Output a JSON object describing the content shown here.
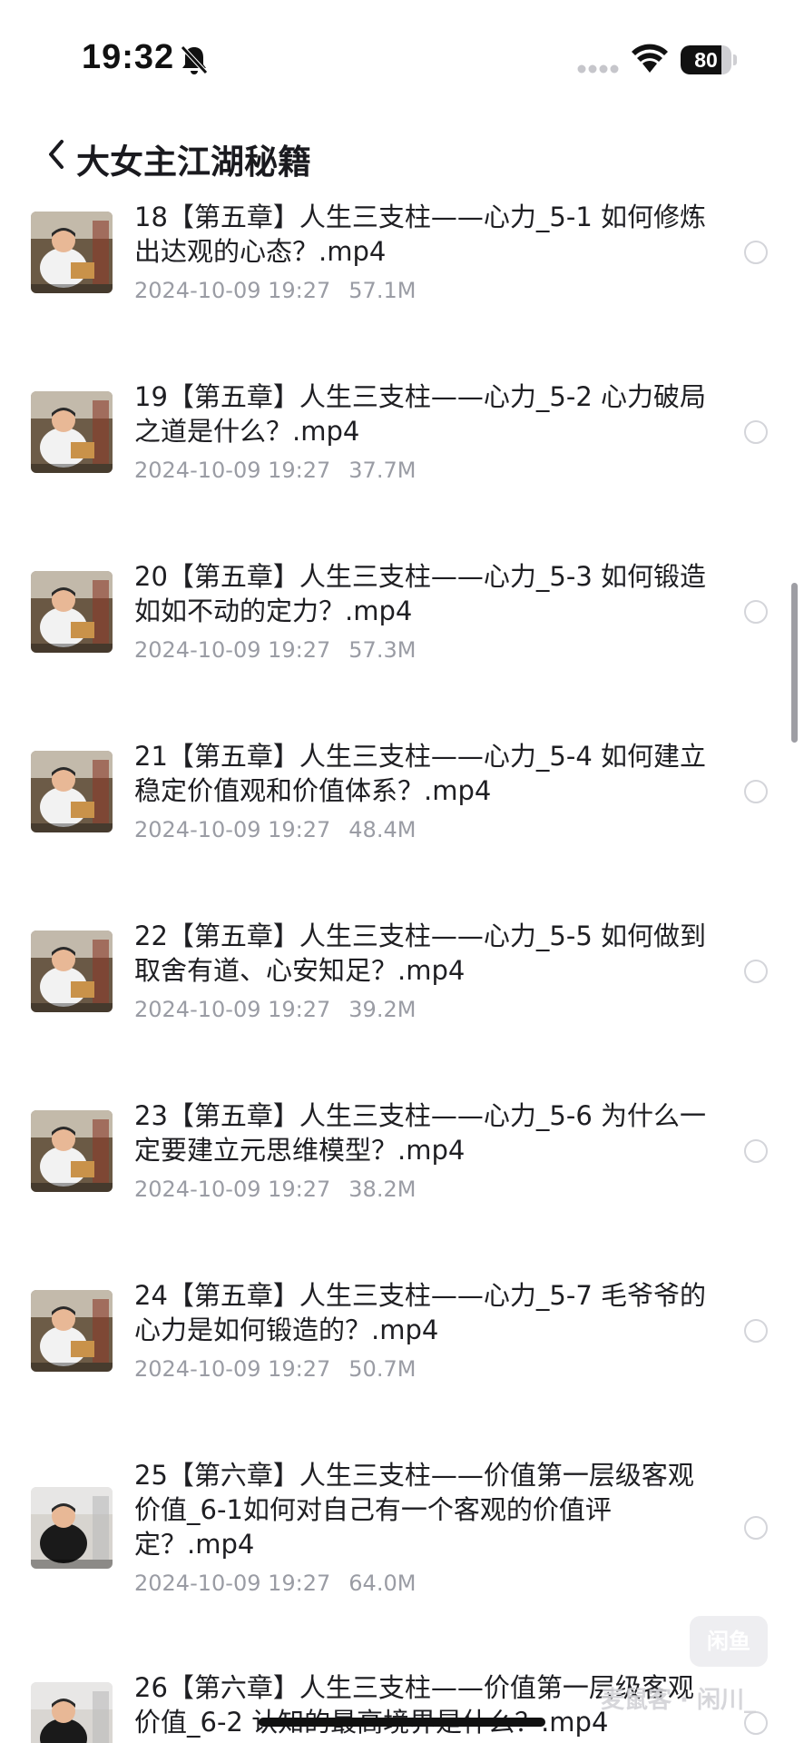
{
  "status_bar": {
    "time": "19:32",
    "battery_level": "80",
    "battery_fraction": 0.8,
    "icons": [
      "bell-slash-icon",
      "signal-dots-icon",
      "wifi-icon",
      "battery-icon"
    ]
  },
  "nav": {
    "back_icon": "chevron-left-icon",
    "title": "大女主江湖秘籍"
  },
  "files": [
    {
      "name": "18【第五章】人生三支柱——心力_5-1 如何修炼出达观的心态？.mp4",
      "date": "2024-10-09 19:27",
      "size": "57.1M"
    },
    {
      "name": "19【第五章】人生三支柱——心力_5-2 心力破局之道是什么？.mp4",
      "date": "2024-10-09 19:27",
      "size": "37.7M"
    },
    {
      "name": "20【第五章】人生三支柱——心力_5-3 如何锻造如如不动的定力？.mp4",
      "date": "2024-10-09 19:27",
      "size": "57.3M"
    },
    {
      "name": "21【第五章】人生三支柱——心力_5-4 如何建立稳定价值观和价值体系？.mp4",
      "date": "2024-10-09 19:27",
      "size": "48.4M"
    },
    {
      "name": "22【第五章】人生三支柱——心力_5-5 如何做到取舍有道、心安知足？.mp4",
      "date": "2024-10-09 19:27",
      "size": "39.2M"
    },
    {
      "name": "23【第五章】人生三支柱——心力_5-6 为什么一定要建立元思维模型？.mp4",
      "date": "2024-10-09 19:27",
      "size": "38.2M"
    },
    {
      "name": "24【第五章】人生三支柱——心力_5-7 毛爷爷的心力是如何锻造的？.mp4",
      "date": "2024-10-09 19:27",
      "size": "50.7M"
    },
    {
      "name": "25【第六章】人生三支柱——价值第一层级客观价值_6-1如何对自己有一个客观的价值评定？.mp4",
      "date": "2024-10-09 19:27",
      "size": "64.0M"
    },
    {
      "name": "26【第六章】人生三支柱——价值第一层级客观价值_6-2 认知的最高境界是什么？.mp4",
      "date": "",
      "size": ""
    }
  ],
  "watermark": {
    "logo": "闲鱼",
    "text": "麦鼠客 · 闲川_"
  },
  "colors": {
    "text_primary": "#1e1e22",
    "text_secondary": "#9a9ca4",
    "radio_border": "#d4d5da",
    "background": "#ffffff"
  }
}
